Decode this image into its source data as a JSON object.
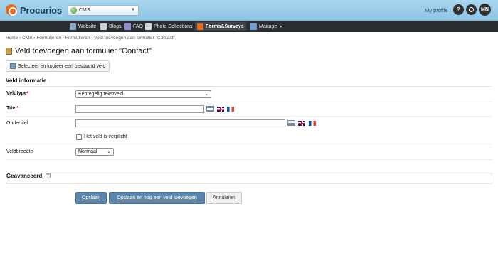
{
  "header": {
    "brand": "Procurios",
    "site_select": {
      "value": "CMS"
    },
    "my_profile": "My profile",
    "help_label": "?",
    "user_initials": "MN"
  },
  "nav": {
    "items": [
      {
        "label": "Website",
        "icon": "website-icon",
        "color": "#8aa9c4"
      },
      {
        "label": "Blogs",
        "icon": "blogs-icon",
        "color": "#c9d3dc"
      },
      {
        "label": "FAQ",
        "icon": "faq-icon",
        "color": "#8f8fd1"
      },
      {
        "label": "Photo Collections",
        "icon": "photo-icon",
        "color": "#d8d8d8"
      },
      {
        "label": "Forms&Surveys",
        "icon": "forms-icon",
        "color": "#e86a1c"
      },
      {
        "label": "Manage",
        "icon": "manage-icon",
        "color": "#6fa0d8",
        "caret": "▾"
      }
    ]
  },
  "breadcrumb": "Home › CMS › Formulieren › Formulieren › Veld toevoegen aan formulier \"Contact\"",
  "page_title": "Veld toevoegen aan formulier \"Contact\"",
  "copy_button": "Selecteer en kopieer een bestaand veld",
  "section": {
    "title": "Veld informatie",
    "fields": {
      "veldtype": {
        "label": "Veldtype",
        "required": "*",
        "value": "Eénregelig tekstveld"
      },
      "titel": {
        "label": "Titel",
        "required": "*",
        "value": ""
      },
      "ondertitel": {
        "label": "Ondertitel",
        "value": ""
      },
      "verplicht": {
        "label": "Het veld is verplicht",
        "checked": false
      },
      "veldbreedte": {
        "label": "Veldbreedte",
        "value": "Normaal"
      }
    }
  },
  "advanced": {
    "title": "Geavanceerd",
    "toggle": "+"
  },
  "buttons": {
    "save": "Opslaan",
    "save_add": "Opslaan en nog een veld toevoegen",
    "cancel": "Annuleren"
  },
  "colors": {
    "accent": "#5b87ad",
    "topbar": "#a9d6ef",
    "navbar": "#2b2f33",
    "required": "#cc1111"
  }
}
